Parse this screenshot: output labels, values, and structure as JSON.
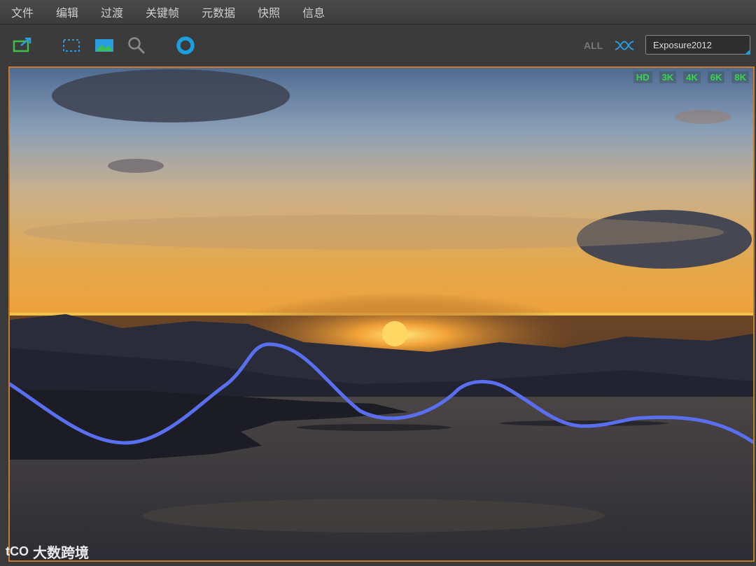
{
  "menu": [
    "文件",
    "编辑",
    "过渡",
    "关键帧",
    "元数据",
    "快照",
    "信息"
  ],
  "toolbar": {
    "icons": [
      "export-icon",
      "marquee-select-icon",
      "image-icon",
      "magnifier-icon",
      "keyframe-circle-icon",
      "curve-toggle-icon"
    ],
    "all_label": "ALL",
    "search_value": "Exposure2012"
  },
  "viewer": {
    "resolutions": [
      "HD",
      "3K",
      "4K",
      "6K",
      "8K"
    ],
    "colors": {
      "frame": "#c47b2c",
      "horizon_line": "#f3c24a",
      "curve": "#5a6ff0",
      "resolution_label": "#39d44a"
    }
  },
  "watermark": {
    "logo": "tCO",
    "text": "大数跨境"
  }
}
